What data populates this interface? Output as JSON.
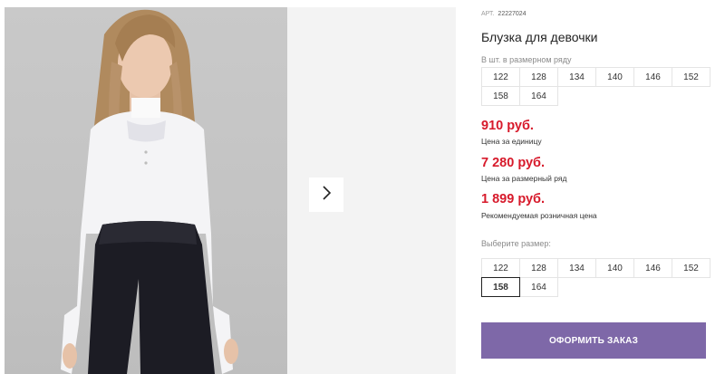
{
  "product": {
    "article_label": "АРТ.",
    "article_value": "22227024",
    "title": "Блузка для девочки"
  },
  "size_row": {
    "label": "В шт. в размерном ряду",
    "sizes": [
      "122",
      "128",
      "134",
      "140",
      "146",
      "152",
      "158",
      "164"
    ]
  },
  "prices": {
    "unit_price": "910 руб.",
    "unit_label": "Цена за единицу",
    "row_price": "7 280 руб.",
    "row_label": "Цена за размерный ряд",
    "retail_price": "1 899 руб.",
    "retail_label": "Рекомендуемая розничная цена"
  },
  "size_select": {
    "label": "Выберите размер:",
    "sizes": [
      "122",
      "128",
      "134",
      "140",
      "146",
      "152",
      "158",
      "164"
    ],
    "selected": "158"
  },
  "order_button": {
    "label": "ОФОРМИТЬ ЗАКАЗ"
  },
  "gallery": {
    "next_icon": "chevron-right-icon"
  },
  "colors": {
    "price": "#d71a2b",
    "order_button": "#7e68a8"
  }
}
